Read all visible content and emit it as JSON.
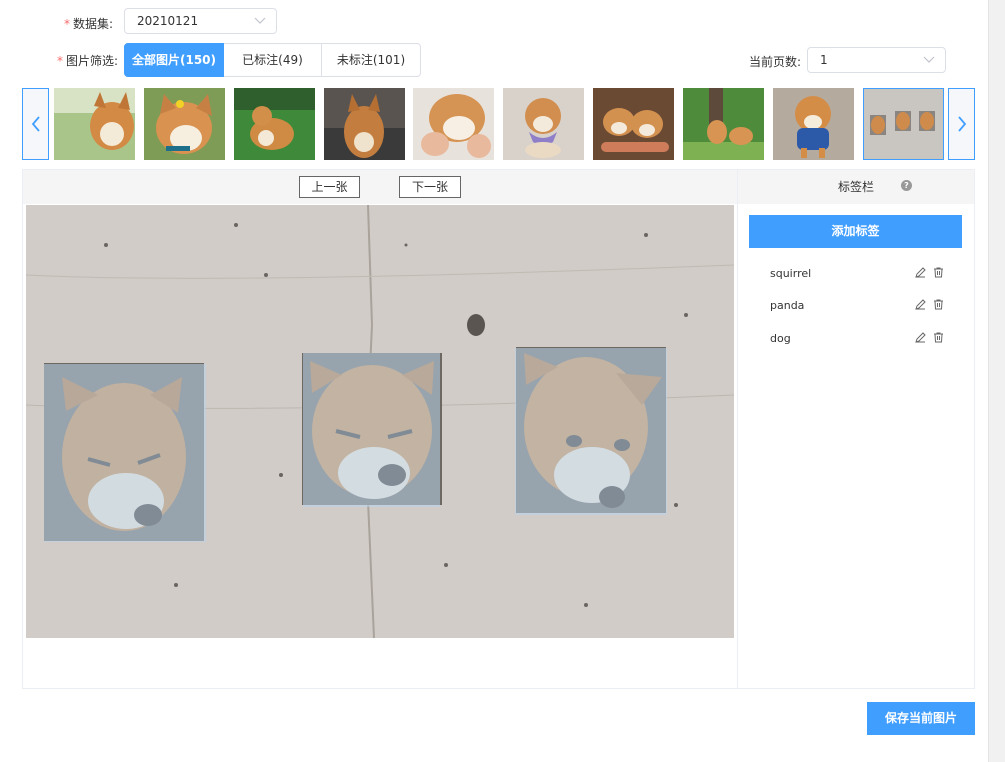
{
  "dataset": {
    "label": "数据集:",
    "value": "20210121"
  },
  "filter": {
    "label": "图片筛选:",
    "options": [
      "全部图片(150)",
      "已标注(49)",
      "未标注(101)"
    ],
    "selected": "全部图片(150)"
  },
  "page": {
    "label": "当前页数:",
    "value": "1"
  },
  "thumbnails": [
    "shiba-grinning-outdoors",
    "shiba-laughing-with-flower",
    "shiba-sitting-on-grass",
    "shiba-portrait-dark",
    "shiba-petted-by-hand",
    "shiba-wearing-scarf",
    "shiba-pair-held",
    "shiba-standing-garden",
    "shiba-in-blue-shirt",
    "shiba-trio-in-wall"
  ],
  "viewer": {
    "prev_label": "上一张",
    "next_label": "下一张"
  },
  "label_panel": {
    "title": "标签栏",
    "help_icon": "question-icon",
    "add_label": "添加标签",
    "tags": [
      "squirrel",
      "panda",
      "dog"
    ]
  },
  "save_label": "保存当前图片",
  "colors": {
    "accent": "#409eff",
    "required": "#f56c6c",
    "annotation": "#bad3eb"
  }
}
